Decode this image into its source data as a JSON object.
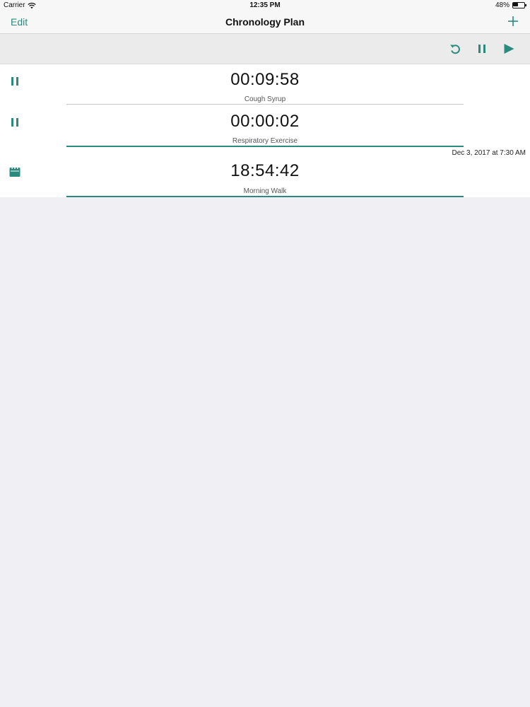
{
  "status_bar": {
    "carrier": "Carrier",
    "time": "12:35 PM",
    "battery_percent_text": "48%",
    "battery_level": 0.48
  },
  "nav": {
    "edit_label": "Edit",
    "title": "Chronology Plan",
    "add_icon": "plus-icon"
  },
  "toolbar": {
    "buttons": [
      {
        "icon": "reset-icon"
      },
      {
        "icon": "pause-icon"
      },
      {
        "icon": "play-icon"
      }
    ]
  },
  "timers": [
    {
      "time": "00:09:58",
      "label": "Cough Syrup",
      "icon": "pause-icon",
      "progress": 0.0,
      "date": ""
    },
    {
      "time": "00:00:02",
      "label": "Respiratory Exercise",
      "icon": "pause-icon",
      "progress": 1.0,
      "date": ""
    },
    {
      "time": "18:54:42",
      "label": "Morning Walk",
      "icon": "calendar-icon",
      "progress": 1.0,
      "date": "Dec 3, 2017 at 7:30 AM"
    }
  ],
  "colors": {
    "accent": "#2a8a7e",
    "background": "#efeff4",
    "progress_track": "#c8c8c8"
  }
}
